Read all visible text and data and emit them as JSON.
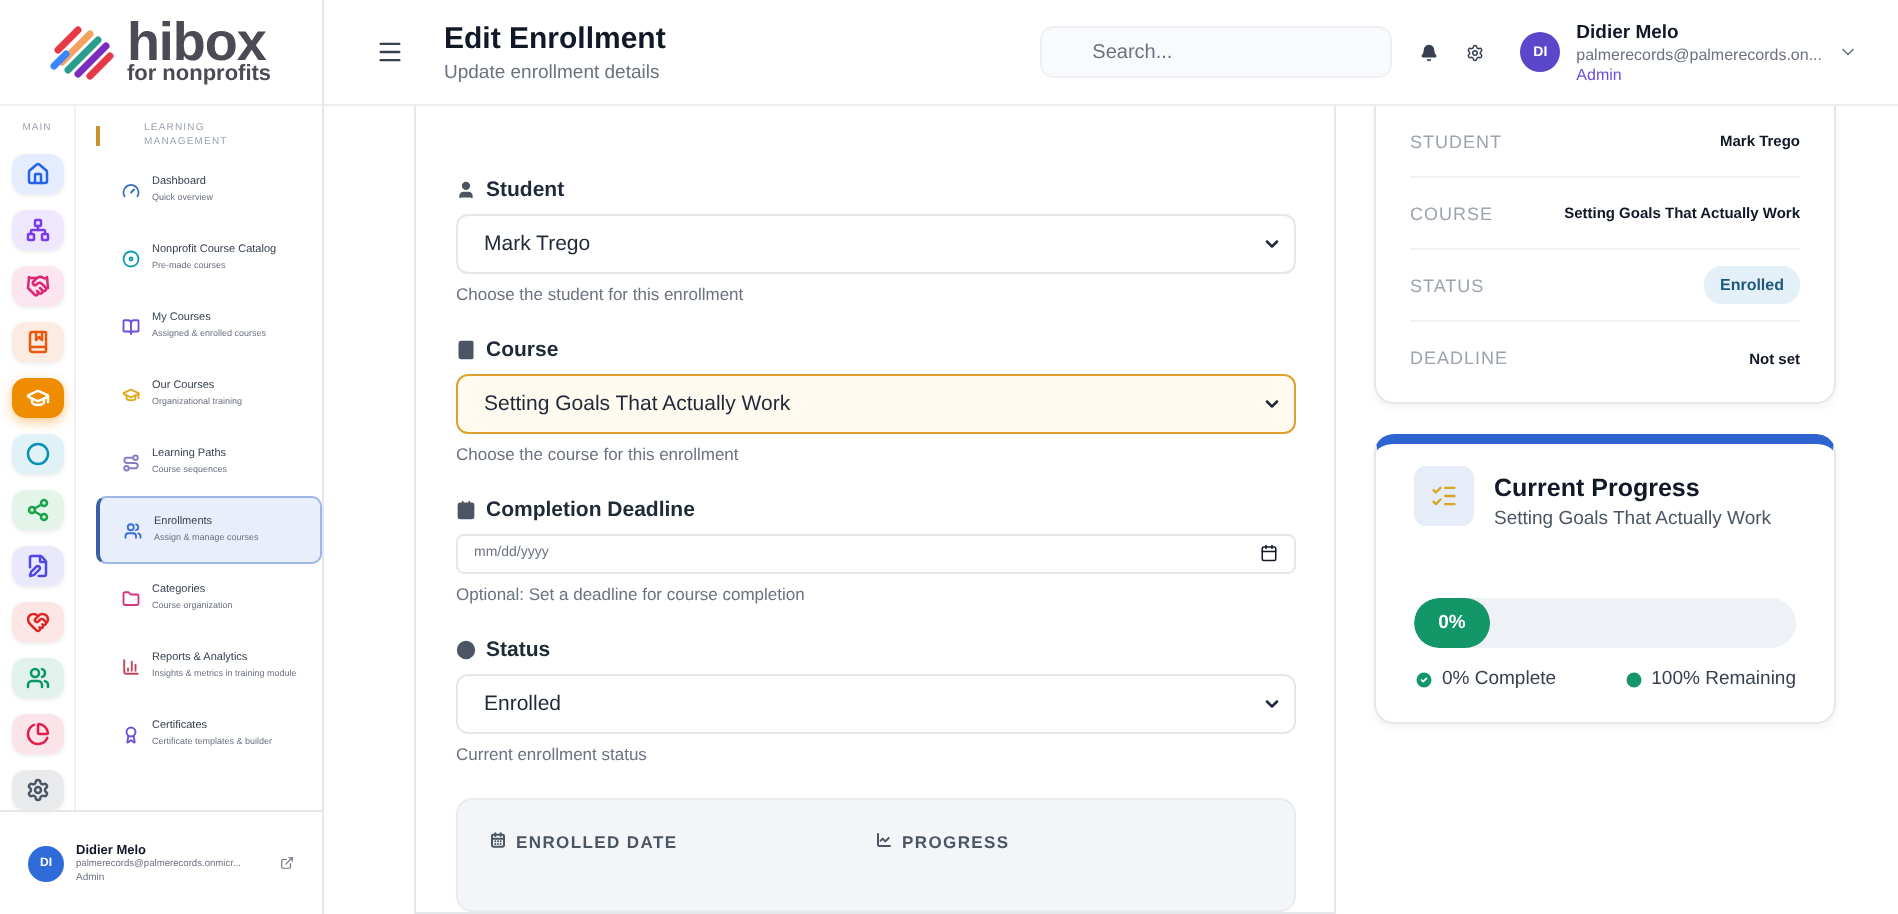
{
  "logo": {
    "name": "hibox",
    "tagline": "for nonprofits"
  },
  "rail": {
    "label": "MAIN",
    "items": [
      {
        "selected": false,
        "color": "#2563eb"
      },
      {
        "selected": false,
        "color": "#7c3aed"
      },
      {
        "selected": false,
        "color": "#db2777"
      },
      {
        "selected": false,
        "color": "#ea580c"
      },
      {
        "selected": true,
        "color": "#f08c00"
      },
      {
        "selected": false,
        "color": "#0891b2"
      },
      {
        "selected": false,
        "color": "#16a34a"
      },
      {
        "selected": false,
        "color": "#4f46e5"
      },
      {
        "selected": false,
        "color": "#dc2626"
      },
      {
        "selected": false,
        "color": "#059669"
      },
      {
        "selected": false,
        "color": "#e11d48"
      },
      {
        "selected": false,
        "color": "#4b5563"
      }
    ]
  },
  "nav": {
    "section": "LEARNING MANAGEMENT",
    "items": [
      {
        "title": "Dashboard",
        "subtitle": "Quick overview",
        "selected": false,
        "color": "#3b6fb6"
      },
      {
        "title": "Nonprofit Course Catalog",
        "subtitle": "Pre-made courses",
        "selected": false,
        "color": "#0e9fb0"
      },
      {
        "title": "My Courses",
        "subtitle": "Assigned & enrolled courses",
        "selected": false,
        "color": "#6d4fd8"
      },
      {
        "title": "Our Courses",
        "subtitle": "Organizational training",
        "selected": false,
        "color": "#e0a81c"
      },
      {
        "title": "Learning Paths",
        "subtitle": "Course sequences",
        "selected": false,
        "color": "#8b7cc8"
      },
      {
        "title": "Enrollments",
        "subtitle": "Assign & manage courses",
        "selected": true,
        "color": "#3b6fd6"
      },
      {
        "title": "Categories",
        "subtitle": "Course organization",
        "selected": false,
        "color": "#d63384"
      },
      {
        "title": "Reports & Analytics",
        "subtitle": "Insights & metrics in training module",
        "selected": false,
        "color": "#c2415b"
      },
      {
        "title": "Certificates",
        "subtitle": "Certificate templates & builder",
        "selected": false,
        "color": "#6d4fd8"
      }
    ]
  },
  "sidebar_user": {
    "initials": "DI",
    "name": "Didier Melo",
    "email": "palmerecords@palmerecords.onmicr...",
    "role": "Admin"
  },
  "header": {
    "title": "Edit Enrollment",
    "subtitle": "Update enrollment details",
    "search": {
      "placeholder": "Search..."
    },
    "user": {
      "initials": "DI",
      "name": "Didier Melo",
      "email": "palmerecords@palmerecords.on...",
      "role": "Admin"
    }
  },
  "form": {
    "fields": [
      {
        "kind": "select",
        "label": "Student",
        "value": "Mark Trego",
        "hint": "Choose the student for this enrollment",
        "focused": false
      },
      {
        "kind": "select",
        "label": "Course",
        "value": "Setting Goals That Actually Work",
        "hint": "Choose the course for this enrollment",
        "focused": true
      },
      {
        "kind": "date",
        "label": "Completion Deadline",
        "placeholder": "mm/dd/yyyy",
        "hint": "Optional: Set a deadline for course completion"
      },
      {
        "kind": "select",
        "label": "Status",
        "value": "Enrolled",
        "hint": "Current enrollment status",
        "focused": false
      }
    ],
    "info_columns": [
      "ENROLLED DATE",
      "PROGRESS"
    ]
  },
  "summary": {
    "rows": [
      {
        "kind": "text",
        "label": "STUDENT",
        "value": "Mark Trego"
      },
      {
        "kind": "text",
        "label": "COURSE",
        "value": "Setting Goals That Actually Work"
      },
      {
        "kind": "badge",
        "label": "STATUS",
        "value": "Enrolled"
      },
      {
        "kind": "text",
        "label": "DEADLINE",
        "value": "Not set"
      }
    ]
  },
  "progress": {
    "title": "Current Progress",
    "subtitle": "Setting Goals That Actually Work",
    "level": 0,
    "reading": "0%",
    "complete": "0% Complete",
    "remaining": "100% Remaining"
  }
}
